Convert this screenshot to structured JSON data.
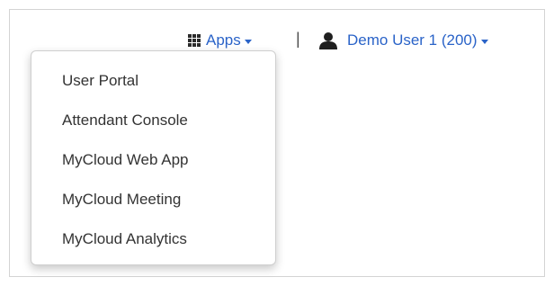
{
  "header": {
    "apps_label": "Apps",
    "divider": "|",
    "user_label": "Demo User 1 (200)"
  },
  "apps_menu": {
    "items": [
      {
        "label": "User Portal"
      },
      {
        "label": "Attendant Console"
      },
      {
        "label": "MyCloud Web App"
      },
      {
        "label": "MyCloud Meeting"
      },
      {
        "label": "MyCloud Analytics"
      }
    ]
  },
  "colors": {
    "link": "#2a63c8",
    "menu_text": "#333333",
    "border": "#d4d4d4"
  },
  "icons": {
    "apps": "grid-icon",
    "user": "user-icon",
    "caret": "caret-down-icon"
  }
}
